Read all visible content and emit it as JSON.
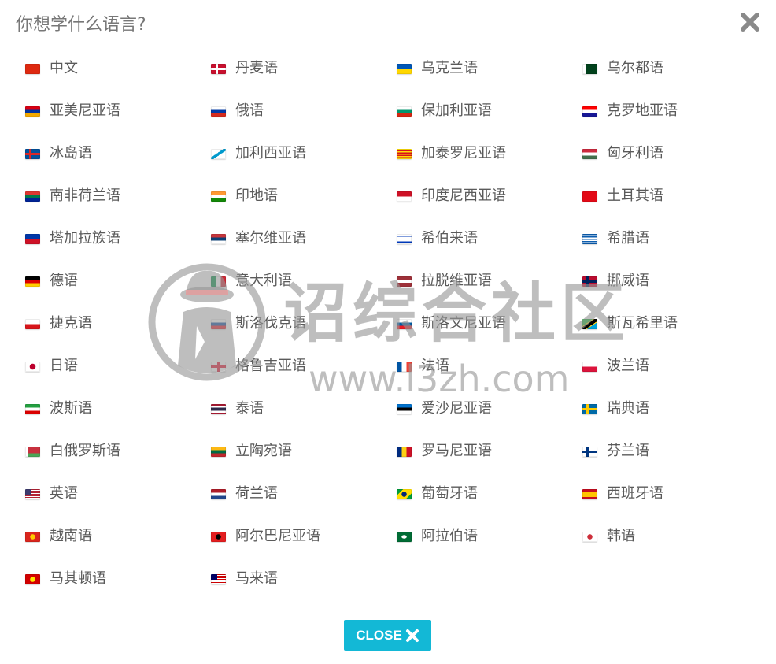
{
  "dialog": {
    "title": "你想学什么语言?",
    "close_button_label": "CLOSE"
  },
  "watermark": {
    "site_name": "诏综合社区",
    "url": "www.l3zh.com"
  },
  "languages": [
    {
      "label": "中文",
      "flag": "china-flag-icon"
    },
    {
      "label": "丹麦语",
      "flag": "denmark-flag-icon"
    },
    {
      "label": "乌克兰语",
      "flag": "ukraine-flag-icon"
    },
    {
      "label": "乌尔都语",
      "flag": "pakistan-flag-icon"
    },
    {
      "label": "亚美尼亚语",
      "flag": "armenia-flag-icon"
    },
    {
      "label": "俄语",
      "flag": "russia-flag-icon"
    },
    {
      "label": "保加利亚语",
      "flag": "bulgaria-flag-icon"
    },
    {
      "label": "克罗地亚语",
      "flag": "croatia-flag-icon"
    },
    {
      "label": "冰岛语",
      "flag": "iceland-flag-icon"
    },
    {
      "label": "加利西亚语",
      "flag": "galicia-flag-icon"
    },
    {
      "label": "加泰罗尼亚语",
      "flag": "catalonia-flag-icon"
    },
    {
      "label": "匈牙利语",
      "flag": "hungary-flag-icon"
    },
    {
      "label": "南非荷兰语",
      "flag": "south-africa-flag-icon"
    },
    {
      "label": "印地语",
      "flag": "india-flag-icon"
    },
    {
      "label": "印度尼西亚语",
      "flag": "indonesia-flag-icon"
    },
    {
      "label": "土耳其语",
      "flag": "turkey-flag-icon"
    },
    {
      "label": "塔加拉族语",
      "flag": "philippines-flag-icon"
    },
    {
      "label": "塞尔维亚语",
      "flag": "serbia-flag-icon"
    },
    {
      "label": "希伯来语",
      "flag": "israel-flag-icon"
    },
    {
      "label": "希腊语",
      "flag": "greece-flag-icon"
    },
    {
      "label": "德语",
      "flag": "germany-flag-icon"
    },
    {
      "label": "意大利语",
      "flag": "italy-flag-icon"
    },
    {
      "label": "拉脱维亚语",
      "flag": "latvia-flag-icon"
    },
    {
      "label": "挪威语",
      "flag": "norway-flag-icon"
    },
    {
      "label": "捷克语",
      "flag": "czech-flag-icon"
    },
    {
      "label": "斯洛伐克语",
      "flag": "slovakia-flag-icon"
    },
    {
      "label": "斯洛文尼亚语",
      "flag": "slovenia-flag-icon"
    },
    {
      "label": "斯瓦希里语",
      "flag": "tanzania-flag-icon"
    },
    {
      "label": "日语",
      "flag": "japan-flag-icon"
    },
    {
      "label": "格鲁吉亚语",
      "flag": "georgia-flag-icon"
    },
    {
      "label": "法语",
      "flag": "france-flag-icon"
    },
    {
      "label": "波兰语",
      "flag": "poland-flag-icon"
    },
    {
      "label": "波斯语",
      "flag": "iran-flag-icon"
    },
    {
      "label": "泰语",
      "flag": "thailand-flag-icon"
    },
    {
      "label": "爱沙尼亚语",
      "flag": "estonia-flag-icon"
    },
    {
      "label": "瑞典语",
      "flag": "sweden-flag-icon"
    },
    {
      "label": "白俄罗斯语",
      "flag": "belarus-flag-icon"
    },
    {
      "label": "立陶宛语",
      "flag": "lithuania-flag-icon"
    },
    {
      "label": "罗马尼亚语",
      "flag": "romania-flag-icon"
    },
    {
      "label": "芬兰语",
      "flag": "finland-flag-icon"
    },
    {
      "label": "英语",
      "flag": "usa-flag-icon"
    },
    {
      "label": "荷兰语",
      "flag": "netherlands-flag-icon"
    },
    {
      "label": "葡萄牙语",
      "flag": "brazil-flag-icon"
    },
    {
      "label": "西班牙语",
      "flag": "spain-flag-icon"
    },
    {
      "label": "越南语",
      "flag": "vietnam-flag-icon"
    },
    {
      "label": "阿尔巴尼亚语",
      "flag": "albania-flag-icon"
    },
    {
      "label": "阿拉伯语",
      "flag": "saudi-arabia-flag-icon"
    },
    {
      "label": "韩语",
      "flag": "south-korea-flag-icon"
    },
    {
      "label": "马其顿语",
      "flag": "macedonia-flag-icon"
    },
    {
      "label": "马来语",
      "flag": "malaysia-flag-icon"
    }
  ],
  "colors": {
    "button_bg": "#13b8d6",
    "close_x": "#8a8a8a"
  }
}
